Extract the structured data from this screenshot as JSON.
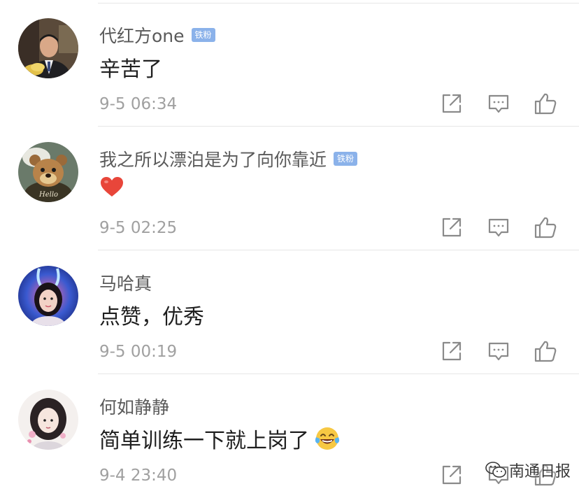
{
  "comments": [
    {
      "username": "代红方one",
      "badge": "铁粉",
      "content": "辛苦了",
      "timestamp": "9-5 06:34",
      "avatar_icon": "avatar-man-suit"
    },
    {
      "username": "我之所以漂泊是为了向你靠近",
      "badge": "铁粉",
      "content": "",
      "content_emoji": "red-heart",
      "timestamp": "9-5 02:25",
      "avatar_icon": "avatar-cartoon-bear",
      "avatar_text": "Hello"
    },
    {
      "username": "马哈真",
      "content": "点赞，优秀",
      "timestamp": "9-5 00:19",
      "avatar_icon": "avatar-girl-bunny-ears"
    },
    {
      "username": "何如静静",
      "content": "简单训练一下就上岗了",
      "content_emoji": "tears-of-joy",
      "timestamp": "9-4 23:40",
      "avatar_icon": "avatar-illustrated-girl"
    }
  ],
  "action_icons": [
    "share-icon",
    "reply-icon",
    "like-icon"
  ],
  "watermark": {
    "text": "南通日报",
    "icon": "wechat-icon"
  },
  "colors": {
    "badge": "#8bb2ea",
    "username": "#5a5a5a",
    "timestamp": "#a0a0a0",
    "icon": "#8a8a8a",
    "divider": "#e6e6e6"
  }
}
